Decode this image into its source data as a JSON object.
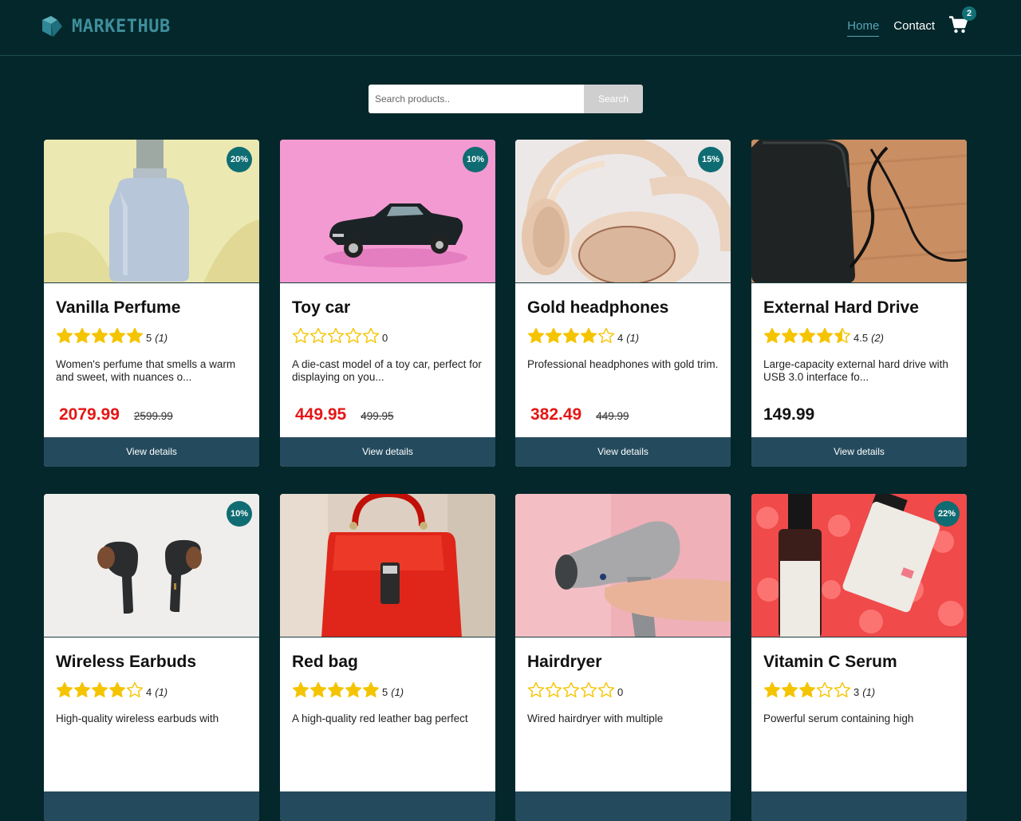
{
  "header": {
    "logo_text": "MARKETHUB",
    "nav": [
      {
        "label": "Home",
        "active": true
      },
      {
        "label": "Contact",
        "active": false
      }
    ],
    "cart_count": "2",
    "cart_icon": "shopping-cart-icon"
  },
  "search": {
    "placeholder": "Search products..",
    "button_label": "Search"
  },
  "colors": {
    "background": "#03272a",
    "accent": "#0f6c72",
    "sale_price": "#e51616",
    "button": "#244a5d",
    "star": "#f5c400"
  },
  "products": [
    {
      "title": "Vanilla Perfume",
      "rating": 5,
      "rating_label": "5",
      "reviews": "(1)",
      "description": "Women's perfume that smells a warm and sweet, with nuances o...",
      "price": "2079.99",
      "old_price": "2599.99",
      "discount": "20%",
      "button": "View details",
      "image": "perfume-bottle"
    },
    {
      "title": "Toy car",
      "rating": 0,
      "rating_label": "0",
      "reviews": "",
      "description": "A die-cast model of a toy car, perfect for displaying on you...",
      "price": "449.95",
      "old_price": "499.95",
      "discount": "10%",
      "button": "View details",
      "image": "toy-car"
    },
    {
      "title": "Gold headphones",
      "rating": 4,
      "rating_label": "4",
      "reviews": "(1)",
      "description": "Professional headphones with gold trim.",
      "price": "382.49",
      "old_price": "449.99",
      "discount": "15%",
      "button": "View details",
      "image": "headphones"
    },
    {
      "title": "External Hard Drive",
      "rating": 4.5,
      "rating_label": "4.5",
      "reviews": "(2)",
      "description": "Large-capacity external hard drive with USB 3.0 interface fo...",
      "price": "149.99",
      "old_price": "",
      "discount": "",
      "button": "View details",
      "image": "hard-drive"
    },
    {
      "title": "Wireless Earbuds",
      "rating": 4,
      "rating_label": "4",
      "reviews": "(1)",
      "description": "High-quality wireless earbuds with",
      "price": "",
      "old_price": "",
      "discount": "10%",
      "button": "",
      "image": "earbuds"
    },
    {
      "title": "Red bag",
      "rating": 5,
      "rating_label": "5",
      "reviews": "(1)",
      "description": "A high-quality red leather bag perfect",
      "price": "",
      "old_price": "",
      "discount": "",
      "button": "",
      "image": "red-bag"
    },
    {
      "title": "Hairdryer",
      "rating": 0,
      "rating_label": "0",
      "reviews": "",
      "description": "Wired hairdryer with multiple",
      "price": "",
      "old_price": "",
      "discount": "",
      "button": "",
      "image": "hairdryer"
    },
    {
      "title": "Vitamin C Serum",
      "rating": 3,
      "rating_label": "3",
      "reviews": "(1)",
      "description": "Powerful serum containing high",
      "price": "",
      "old_price": "",
      "discount": "22%",
      "button": "",
      "image": "serum"
    }
  ]
}
